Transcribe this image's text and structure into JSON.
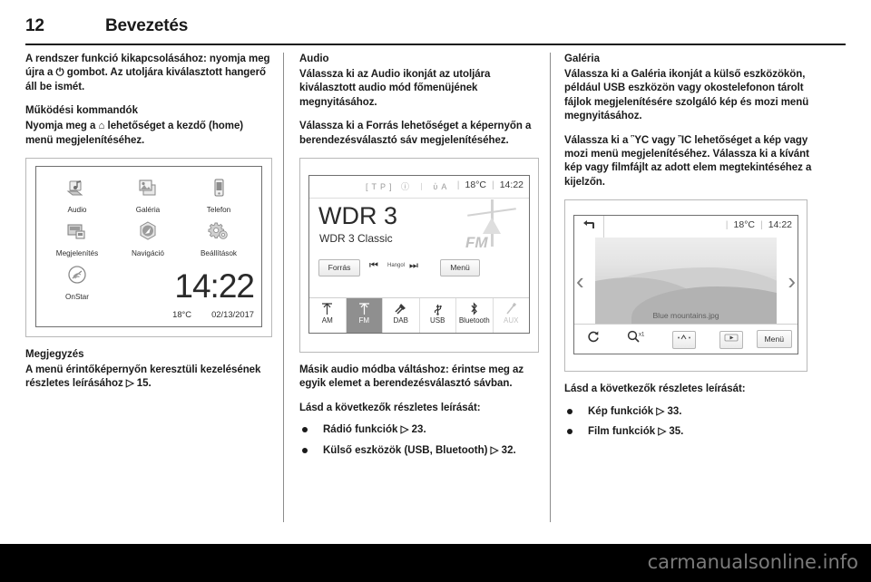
{
  "header": {
    "page_number": "12",
    "chapter": "Bevezetés"
  },
  "column1": {
    "para1": "A rendszer funkció kikapcsolásához: nyomja meg újra a ⏻ gombot. Az utoljára kiválasztott hangerő áll be ismét.",
    "heading1": "Működési kommandók",
    "para2": "Nyomja meg a ⌂ lehetőséget a kezdő (home) menü megjelenítéséhez.",
    "note_heading": "Megjegyzés",
    "note_text": "A menü érintőképernyőn keresztüli kezelésének részletes leírásához ▷ 15."
  },
  "home_screen": {
    "apps": [
      {
        "label": "Audio",
        "icon": "audio-note-icon"
      },
      {
        "label": "Galéria",
        "icon": "gallery-photos-icon"
      },
      {
        "label": "Telefon",
        "icon": "phone-icon"
      },
      {
        "label": "Megjelenítés",
        "icon": "display-icon"
      },
      {
        "label": "Navigáció",
        "icon": "navigation-compass-icon"
      },
      {
        "label": "Beállítások",
        "icon": "settings-gears-icon"
      },
      {
        "label": "OnStar",
        "icon": "onstar-icon"
      }
    ],
    "clock": "14:22",
    "temperature": "18°C",
    "date": "02/13/2017"
  },
  "column2": {
    "heading": "Audio",
    "para1": "Válassza ki az Audio ikonját az utoljára kiválasztott audio mód főmenüjének megnyitásához.",
    "para2": "Válassza ki a Forrás lehetőséget a képernyőn a berendezésválasztó sáv megjelenítéséhez.",
    "para3": "Másik audio módba váltáshoz: érintse meg az egyik elemet a berendezésválasztó sávban.",
    "see_also": "Lásd a következők részletes leírását:",
    "bullets": [
      "Rádió funkciók ▷ 23.",
      "Külső eszközök (USB, Bluetooth) ▷ 32."
    ]
  },
  "radio_screen": {
    "status_icons": "[TP]  ⓘ  ᛁ  ὐA",
    "temperature": "18°C",
    "clock": "14:22",
    "station_name": "WDR 3",
    "station_info": "WDR 3 Classic",
    "source_button": "Forrás",
    "prev_button": "⏮",
    "band_label": "Hangol",
    "next_button": "⏭",
    "menu_button": "Menü",
    "band_logo": "FM",
    "sources": [
      {
        "name": "AM",
        "icon": "antenna-icon",
        "state": "normal"
      },
      {
        "name": "FM",
        "icon": "antenna-icon",
        "state": "selected"
      },
      {
        "name": "DAB",
        "icon": "satellite-icon",
        "state": "normal"
      },
      {
        "name": "USB",
        "icon": "usb-icon",
        "state": "normal"
      },
      {
        "name": "Bluetooth",
        "icon": "bluetooth-icon",
        "state": "normal"
      },
      {
        "name": "AUX",
        "icon": "aux-jack-icon",
        "state": "dimmed"
      }
    ]
  },
  "column3": {
    "heading": "Galéria",
    "para1": "Válassza ki a Galéria ikonját a külső eszközökön, például USB eszközön vagy okostelefonon tárolt fájlok megjelenítésére szolgáló kép és mozi menü megnyitásához.",
    "para2": "Válassza ki a ὛC vagy ἺC lehetőséget a kép vagy mozi menü megjelenítéséhez. Válassza ki a kívánt kép vagy filmfájlt az adott elem megtekintéséhez a kijelzőn.",
    "see_also": "Lásd a következők részletes leírását:",
    "bullets": [
      "Kép funkciók ▷ 33.",
      "Film funkciók ▷ 35."
    ]
  },
  "gallery_screen": {
    "back_icon": "back-arrow-icon",
    "temperature": "18°C",
    "clock": "14:22",
    "file_name": "Blue mountains.jpg",
    "prev_icon": "chevron-left-icon",
    "next_icon": "chevron-right-icon",
    "tools": [
      {
        "icon": "rotate-icon",
        "label": "↻"
      },
      {
        "icon": "zoom-icon",
        "label": "x1"
      },
      {
        "icon": "adjust-icon",
        "label": "•/•"
      },
      {
        "icon": "slideshow-play-icon",
        "label": "▶"
      }
    ],
    "menu_button": "Menü"
  },
  "footer": {
    "watermark": "carmanualsonline.info"
  }
}
